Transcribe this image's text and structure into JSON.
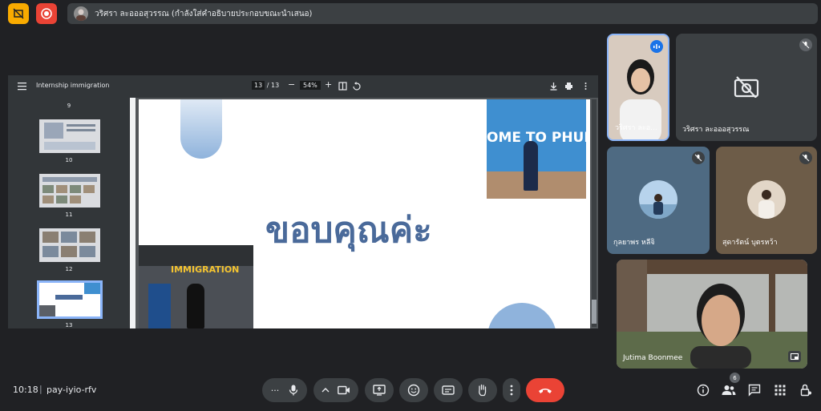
{
  "banner": {
    "text": "วริศรา ละอออสุวรรณ (กำลังใส่คำอธิบายประกอบขณะนำเสนอ)"
  },
  "pdf": {
    "title": "Internship immigration",
    "page_current": "13",
    "page_total": "/ 13",
    "zoom": "54%",
    "thumbnails": [
      {
        "label": "9"
      },
      {
        "label": "10"
      },
      {
        "label": "11"
      },
      {
        "label": "12"
      },
      {
        "label": "13"
      }
    ],
    "slide_text": "ขอบคุณค่ะ",
    "photo_banner_text": "OME TO PHUK",
    "photo_sign_text": "IMMIGRATION"
  },
  "participants": [
    {
      "name": "วริศรา ละอ..."
    },
    {
      "name": "วริศรา ละอออสุวรรณ"
    },
    {
      "name": "กุลยาพร หลีจิ"
    },
    {
      "name": "สุดารัตน์ บุตรหว้า"
    },
    {
      "name": "Jutima Boonmee"
    }
  ],
  "bottom": {
    "time": "10:18",
    "separator": "|",
    "meeting_code": "pay-iyio-rfv",
    "more_label": "···",
    "participant_count": "6"
  },
  "colors": {
    "background": "#202124",
    "accent_blue": "#8ab4f8",
    "end_call": "#ea4335",
    "yellow_button": "#f9ab00"
  }
}
